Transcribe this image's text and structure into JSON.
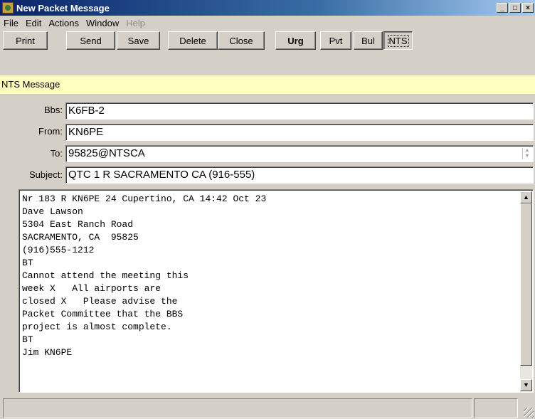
{
  "window": {
    "title": "New Packet Message",
    "controls": {
      "minimize": "_",
      "maximize": "□",
      "close": "×"
    }
  },
  "menu": {
    "items": [
      {
        "label": "File",
        "disabled": false
      },
      {
        "label": "Edit",
        "disabled": false
      },
      {
        "label": "Actions",
        "disabled": false
      },
      {
        "label": "Window",
        "disabled": false
      },
      {
        "label": "Help",
        "disabled": true
      }
    ]
  },
  "toolbar": {
    "print": "Print",
    "send": "Send",
    "save": "Save",
    "delete": "Delete",
    "close": "Close",
    "urg": "Urg",
    "pvt": "Pvt",
    "bul": "Bul",
    "nts": "NTS"
  },
  "message_type": "NTS Message",
  "fields": {
    "bbs_label": "Bbs:",
    "bbs_value": "K6FB-2",
    "from_label": "From:",
    "from_value": "KN6PE",
    "to_label": "To:",
    "to_value": "95825@NTSCA",
    "subject_label": "Subject:",
    "subject_value": "QTC 1 R SACRAMENTO CA (916-555)"
  },
  "message_body": "Nr 183 R KN6PE 24 Cupertino, CA 14:42 Oct 23\nDave Lawson\n5304 East Ranch Road\nSACRAMENTO, CA  95825\n(916)555-1212\nBT\nCannot attend the meeting this\nweek X   All airports are\nclosed X   Please advise the\nPacket Committee that the BBS\nproject is almost complete.\nBT\nJim KN6PE",
  "colors": {
    "titlebar_start": "#0a246a",
    "nts_bar": "#ffffc0",
    "face": "#d4d0c8"
  }
}
